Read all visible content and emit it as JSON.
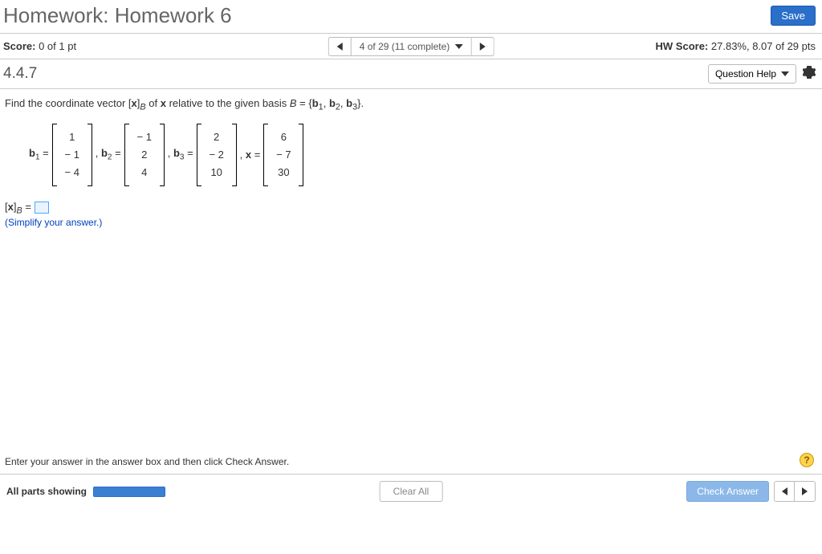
{
  "header": {
    "title": "Homework: Homework 6",
    "save_label": "Save"
  },
  "scorebar": {
    "score_label": "Score:",
    "score_value": "0 of 1 pt",
    "nav_text": "4 of 29 (11 complete)",
    "hw_label": "HW Score:",
    "hw_value": "27.83%, 8.07 of 29 pts"
  },
  "question": {
    "number": "4.4.7",
    "help_label": "Question Help"
  },
  "problem": {
    "prompt_pre": "Find the coordinate vector ",
    "prompt_mid1": " of ",
    "prompt_mid2": " relative to the given basis ",
    "basis_set": "B = {b₁, b₂, b₃}.",
    "labels": {
      "b1": "b",
      "b2": "b",
      "b3": "b",
      "x": "x",
      "eq": " = ",
      "comma": ", "
    },
    "b1": [
      "1",
      "− 1",
      "− 4"
    ],
    "b2": [
      "− 1",
      "2",
      "4"
    ],
    "b3": [
      "2",
      "− 2",
      "10"
    ],
    "x": [
      "6",
      "− 7",
      "30"
    ],
    "answer_label_pre": "[x]",
    "answer_label_sub": "B",
    "answer_eq": " = ",
    "hint": "(Simplify your answer.)"
  },
  "footer": {
    "note": "Enter your answer in the answer box and then click Check Answer.",
    "parts_label": "All parts showing",
    "clear_label": "Clear All",
    "check_label": "Check Answer"
  }
}
